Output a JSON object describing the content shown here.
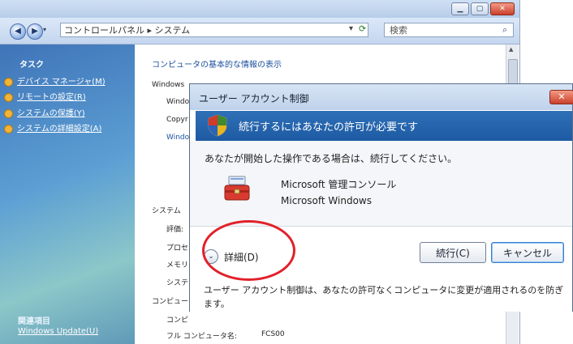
{
  "explorer": {
    "breadcrumb": "コントロールパネル ▸ システム",
    "search_placeholder": "検索",
    "sidebar": {
      "tasks_heading": "タスク",
      "tasks": [
        "デバイス マネージャ(M)",
        "リモートの設定(R)",
        "システムの保護(Y)",
        "システムの詳細設定(A)"
      ],
      "related_heading": "関連項目",
      "related": [
        "Windows Update(U)"
      ]
    },
    "main": {
      "heading": "コンピュータの基本的な情報の表示",
      "windows_label": "Windows",
      "windows_lines": [
        "Windo",
        "Copyr",
        "Windo"
      ],
      "system_label": "システム",
      "system_rows": [
        "評価:",
        "プロセ",
        "メモリ",
        "システ"
      ],
      "computer_label": "コンピュー",
      "computer_rows": [
        "コンピ"
      ],
      "fullname_label": "フル コンピュータ名:",
      "fullname_value": "FCS00"
    }
  },
  "uac": {
    "title": "ユーザー アカウント制御",
    "banner": "続行するにはあなたの許可が必要です",
    "instruction": "あなたが開始した操作である場合は、続行してください。",
    "program": "Microsoft 管理コンソール",
    "publisher": "Microsoft Windows",
    "details_label": "詳細(D)",
    "continue_label": "続行(C)",
    "cancel_label": "キャンセル",
    "footer_text": "ユーザー アカウント制御は、あなたの許可なくコンピュータに変更が適用されるのを防ぎます。"
  },
  "colors": {
    "banner": "#1d5aa3",
    "highlight_circle": "#e2202a"
  }
}
